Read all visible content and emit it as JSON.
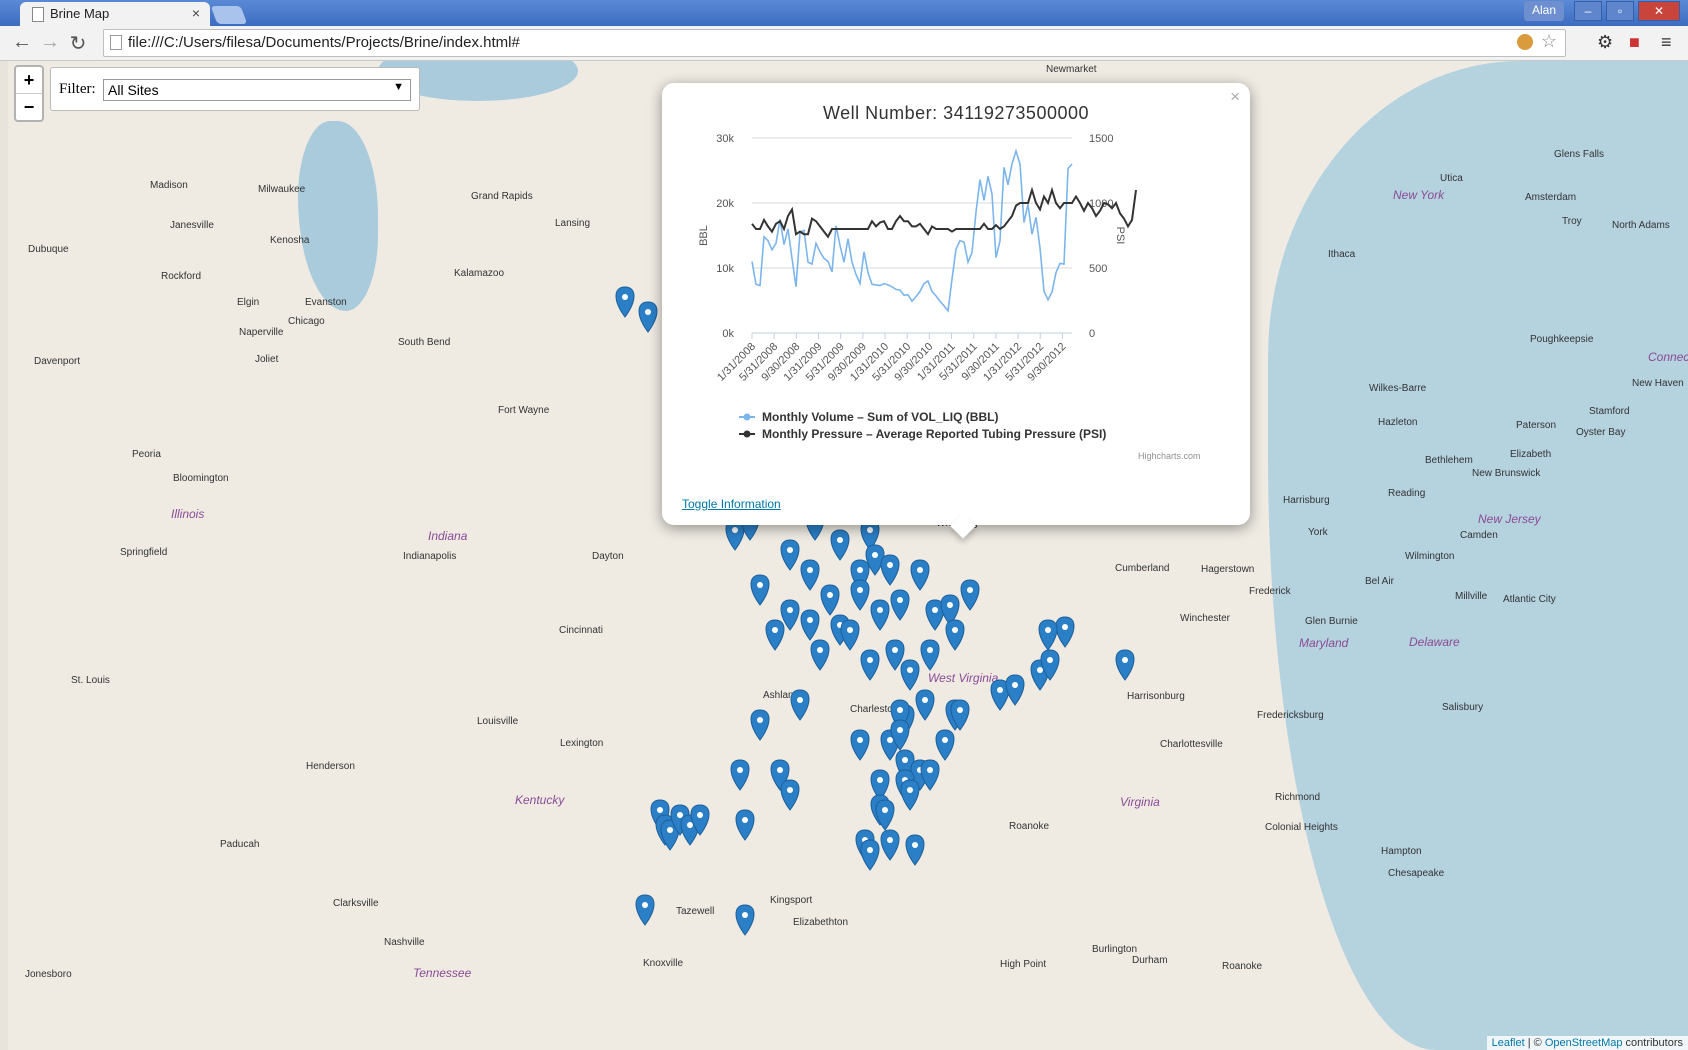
{
  "browser": {
    "tab_title": "Brine Map",
    "tab_close": "×",
    "user": "Alan",
    "min": "–",
    "max": "▫",
    "close": "✕",
    "url": "file:///C:/Users/filesa/Documents/Projects/Brine/index.html#"
  },
  "map": {
    "zoom_in": "+",
    "zoom_out": "−",
    "filter_label": "Filter:",
    "filter_value": "All Sites",
    "cities": [
      {
        "name": "Madison",
        "x": 142,
        "y": 119
      },
      {
        "name": "Milwaukee",
        "x": 250,
        "y": 123
      },
      {
        "name": "Grand Rapids",
        "x": 463,
        "y": 130
      },
      {
        "name": "Lansing",
        "x": 547,
        "y": 157
      },
      {
        "name": "Janesville",
        "x": 162,
        "y": 159
      },
      {
        "name": "Kenosha",
        "x": 262,
        "y": 174
      },
      {
        "name": "Dubuque",
        "x": 20,
        "y": 183
      },
      {
        "name": "Rockford",
        "x": 153,
        "y": 210
      },
      {
        "name": "Kalamazoo",
        "x": 446,
        "y": 207
      },
      {
        "name": "Elgin",
        "x": 229,
        "y": 236
      },
      {
        "name": "Evanston",
        "x": 297,
        "y": 236
      },
      {
        "name": "Chicago",
        "x": 280,
        "y": 255
      },
      {
        "name": "Naperville",
        "x": 231,
        "y": 266
      },
      {
        "name": "South Bend",
        "x": 390,
        "y": 276
      },
      {
        "name": "Joliet",
        "x": 247,
        "y": 293
      },
      {
        "name": "Davenport",
        "x": 26,
        "y": 295
      },
      {
        "name": "Fort Wayne",
        "x": 490,
        "y": 344
      },
      {
        "name": "Peoria",
        "x": 124,
        "y": 388
      },
      {
        "name": "Bloomington",
        "x": 165,
        "y": 412
      },
      {
        "name": "Dayton",
        "x": 584,
        "y": 490
      },
      {
        "name": "Springfield",
        "x": 112,
        "y": 486
      },
      {
        "name": "Indianapolis",
        "x": 395,
        "y": 490
      },
      {
        "name": "Cincinnati",
        "x": 551,
        "y": 564
      },
      {
        "name": "St. Louis",
        "x": 63,
        "y": 614
      },
      {
        "name": "Ashland",
        "x": 755,
        "y": 629
      },
      {
        "name": "Louisville",
        "x": 469,
        "y": 655
      },
      {
        "name": "Lexington",
        "x": 552,
        "y": 677
      },
      {
        "name": "Charleston",
        "x": 842,
        "y": 643
      },
      {
        "name": "Henderson",
        "x": 298,
        "y": 700
      },
      {
        "name": "Paducah",
        "x": 212,
        "y": 778
      },
      {
        "name": "Clarksville",
        "x": 325,
        "y": 837
      },
      {
        "name": "Nashville",
        "x": 376,
        "y": 876
      },
      {
        "name": "Tazewell",
        "x": 668,
        "y": 845
      },
      {
        "name": "Kingsport",
        "x": 762,
        "y": 834
      },
      {
        "name": "Elizabethton",
        "x": 785,
        "y": 856
      },
      {
        "name": "Knoxville",
        "x": 635,
        "y": 897
      },
      {
        "name": "Jonesboro",
        "x": 17,
        "y": 908
      },
      {
        "name": "Wheeling",
        "x": 928,
        "y": 457
      },
      {
        "name": "Cumberland",
        "x": 1107,
        "y": 502
      },
      {
        "name": "Hagerstown",
        "x": 1193,
        "y": 503
      },
      {
        "name": "Winchester",
        "x": 1172,
        "y": 552
      },
      {
        "name": "Frederick",
        "x": 1241,
        "y": 525
      },
      {
        "name": "Harrisonburg",
        "x": 1119,
        "y": 630
      },
      {
        "name": "Fredericksburg",
        "x": 1249,
        "y": 649
      },
      {
        "name": "Charlottesville",
        "x": 1152,
        "y": 678
      },
      {
        "name": "Richmond",
        "x": 1267,
        "y": 731
      },
      {
        "name": "Colonial Heights",
        "x": 1257,
        "y": 761
      },
      {
        "name": "Roanoke",
        "x": 1001,
        "y": 760
      },
      {
        "name": "Hampton",
        "x": 1373,
        "y": 785
      },
      {
        "name": "Chesapeake",
        "x": 1380,
        "y": 807
      },
      {
        "name": "Burlington",
        "x": 1084,
        "y": 883
      },
      {
        "name": "Durham",
        "x": 1124,
        "y": 894
      },
      {
        "name": "High Point",
        "x": 992,
        "y": 898
      },
      {
        "name": "Roanoke",
        "x": 1214,
        "y": 900
      },
      {
        "name": "Harrisburg",
        "x": 1275,
        "y": 434
      },
      {
        "name": "Reading",
        "x": 1380,
        "y": 427
      },
      {
        "name": "York",
        "x": 1300,
        "y": 466
      },
      {
        "name": "Bel Air",
        "x": 1357,
        "y": 515
      },
      {
        "name": "Glen Burnie",
        "x": 1297,
        "y": 555
      },
      {
        "name": "Millville",
        "x": 1447,
        "y": 530
      },
      {
        "name": "Atlantic City",
        "x": 1495,
        "y": 533
      },
      {
        "name": "Salisbury",
        "x": 1434,
        "y": 641
      },
      {
        "name": "Camden",
        "x": 1452,
        "y": 469
      },
      {
        "name": "Wilmington",
        "x": 1397,
        "y": 490
      },
      {
        "name": "Bethlehem",
        "x": 1417,
        "y": 394
      },
      {
        "name": "Hazleton",
        "x": 1370,
        "y": 356
      },
      {
        "name": "Wilkes-Barre",
        "x": 1361,
        "y": 322
      },
      {
        "name": "Elizabeth",
        "x": 1502,
        "y": 388
      },
      {
        "name": "New Brunswick",
        "x": 1464,
        "y": 407
      },
      {
        "name": "Paterson",
        "x": 1508,
        "y": 359
      },
      {
        "name": "Oyster Bay",
        "x": 1568,
        "y": 366
      },
      {
        "name": "Stamford",
        "x": 1581,
        "y": 345
      },
      {
        "name": "New Haven",
        "x": 1624,
        "y": 317
      },
      {
        "name": "Poughkeepsie",
        "x": 1522,
        "y": 273
      },
      {
        "name": "Ithaca",
        "x": 1320,
        "y": 188
      },
      {
        "name": "Utica",
        "x": 1432,
        "y": 112
      },
      {
        "name": "Amsterdam",
        "x": 1517,
        "y": 131
      },
      {
        "name": "Troy",
        "x": 1554,
        "y": 155
      },
      {
        "name": "North Adams",
        "x": 1604,
        "y": 159
      },
      {
        "name": "Glens Falls",
        "x": 1546,
        "y": 88
      },
      {
        "name": "Newmarket",
        "x": 1038,
        "y": 3
      }
    ],
    "states": [
      {
        "name": "Illinois",
        "x": 163,
        "y": 446
      },
      {
        "name": "Indiana",
        "x": 420,
        "y": 468
      },
      {
        "name": "Kentucky",
        "x": 507,
        "y": 732
      },
      {
        "name": "West Virginia",
        "x": 920,
        "y": 610
      },
      {
        "name": "Virginia",
        "x": 1112,
        "y": 734
      },
      {
        "name": "Maryland",
        "x": 1291,
        "y": 575
      },
      {
        "name": "Delaware",
        "x": 1401,
        "y": 574
      },
      {
        "name": "New Jersey",
        "x": 1470,
        "y": 451
      },
      {
        "name": "New York",
        "x": 1385,
        "y": 127
      },
      {
        "name": "Tennessee",
        "x": 405,
        "y": 905
      },
      {
        "name": "Connecticut",
        "x": 1640,
        "y": 289
      }
    ],
    "attribution_leaflet": "Leaflet",
    "attribution_sep": " | © ",
    "attribution_osm": "OpenStreetMap",
    "attribution_tail": " contributors"
  },
  "popup": {
    "close": "×",
    "title": "Well Number: 34119273500000",
    "toggle": "Toggle Information",
    "credits": "Highcharts.com"
  },
  "chart_data": {
    "type": "line",
    "title": "Well Number: 34119273500000",
    "x_ticks": [
      "1/31/2008",
      "5/31/2008",
      "9/30/2008",
      "1/31/2009",
      "5/31/2009",
      "9/30/2009",
      "1/31/2010",
      "5/31/2010",
      "9/30/2010",
      "1/31/2011",
      "5/31/2011",
      "9/30/2011",
      "1/31/2012",
      "5/31/2012",
      "9/30/2012"
    ],
    "y_left": {
      "label": "BBL",
      "ticks": [
        "0k",
        "10k",
        "20k",
        "30k"
      ],
      "range": [
        0,
        30000
      ]
    },
    "y_right": {
      "label": "PSI",
      "ticks": [
        "0",
        "500",
        "1000",
        "1500"
      ],
      "range": [
        0,
        1500
      ]
    },
    "series": [
      {
        "name": "Monthly Volume - Sum of VOL_LIQ (BBL)",
        "axis": "left",
        "color": "#7cb5ec",
        "values": [
          11000,
          7500,
          7300,
          14800,
          14200,
          12800,
          13800,
          17500,
          13600,
          16000,
          11500,
          7100,
          15500,
          15800,
          10900,
          10600,
          13800,
          12500,
          11500,
          11000,
          9400,
          16500,
          13500,
          10900,
          14500,
          10900,
          9000,
          7600,
          12500,
          9300,
          7500,
          7400,
          7300,
          7600,
          7400,
          7100,
          6700,
          6600,
          5800,
          5900,
          4900,
          5600,
          6400,
          7600,
          8000,
          6400,
          5700,
          4900,
          4200,
          3400,
          8300,
          12900,
          14200,
          14000,
          10900,
          12400,
          18600,
          23600,
          20400,
          24100,
          21400,
          11600,
          14200,
          25500,
          22800,
          26000,
          28000,
          26000,
          17000,
          19800,
          15200,
          17800,
          13100,
          6400,
          5100,
          6300,
          9300,
          10700,
          10600,
          25300,
          26000
        ]
      },
      {
        "name": "Monthly Pressure - Average Reported Tubing Pressure (PSI)",
        "axis": "right",
        "color": "#333333",
        "values": [
          840,
          800,
          800,
          870,
          820,
          780,
          840,
          860,
          800,
          900,
          950,
          760,
          780,
          760,
          760,
          880,
          860,
          820,
          780,
          740,
          800,
          800,
          800,
          800,
          800,
          800,
          800,
          800,
          800,
          800,
          860,
          820,
          850,
          860,
          800,
          800,
          860,
          900,
          860,
          860,
          820,
          820,
          840,
          800,
          760,
          820,
          800,
          800,
          800,
          800,
          780,
          800,
          800,
          800,
          800,
          800,
          800,
          800,
          840,
          800,
          800,
          830,
          800,
          820,
          860,
          900,
          980,
          1000,
          1000,
          1000,
          1100,
          1000,
          950,
          1050,
          1000,
          1100,
          1000,
          960,
          1000,
          1000,
          1000,
          1050,
          1000,
          940,
          1000,
          960,
          900,
          940,
          1000,
          990,
          960,
          1000,
          920,
          880,
          820,
          870,
          1100
        ]
      }
    ],
    "legend": [
      "Monthly Volume – Sum of VOL_LIQ (BBL)",
      "Monthly Pressure – Average Reported Tubing Pressure (PSI)"
    ]
  }
}
